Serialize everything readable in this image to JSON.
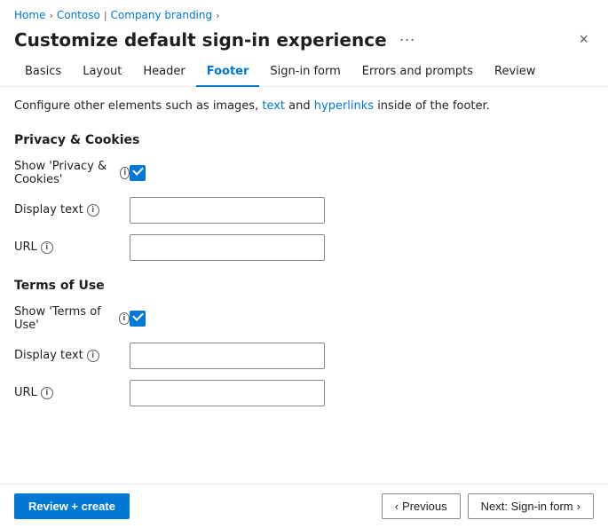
{
  "breadcrumb": {
    "items": [
      "Home",
      "Contoso",
      "Company branding"
    ],
    "separators": [
      ">",
      ">",
      ">"
    ]
  },
  "header": {
    "title": "Customize default sign-in experience",
    "more_options_label": "···",
    "close_label": "×"
  },
  "tabs": [
    {
      "label": "Basics",
      "active": false
    },
    {
      "label": "Layout",
      "active": false
    },
    {
      "label": "Header",
      "active": false
    },
    {
      "label": "Footer",
      "active": true
    },
    {
      "label": "Sign-in form",
      "active": false
    },
    {
      "label": "Errors and prompts",
      "active": false
    },
    {
      "label": "Review",
      "active": false
    }
  ],
  "info_text": "Configure other elements such as images, text and hyperlinks inside of the footer.",
  "sections": [
    {
      "heading": "Privacy & Cookies",
      "fields": [
        {
          "label": "Show 'Privacy & Cookies'",
          "type": "checkbox",
          "checked": true,
          "has_info": true
        },
        {
          "label": "Display text",
          "type": "text",
          "value": "",
          "has_info": true
        },
        {
          "label": "URL",
          "type": "text",
          "value": "",
          "has_info": true
        }
      ]
    },
    {
      "heading": "Terms of Use",
      "fields": [
        {
          "label": "Show 'Terms of Use'",
          "type": "checkbox",
          "checked": true,
          "has_info": true
        },
        {
          "label": "Display text",
          "type": "text",
          "value": "",
          "has_info": true
        },
        {
          "label": "URL",
          "type": "text",
          "value": "",
          "has_info": true
        }
      ]
    }
  ],
  "footer": {
    "review_create_label": "Review + create",
    "previous_label": "Previous",
    "next_label": "Next: Sign-in form",
    "prev_icon": "‹",
    "next_icon": "›"
  }
}
